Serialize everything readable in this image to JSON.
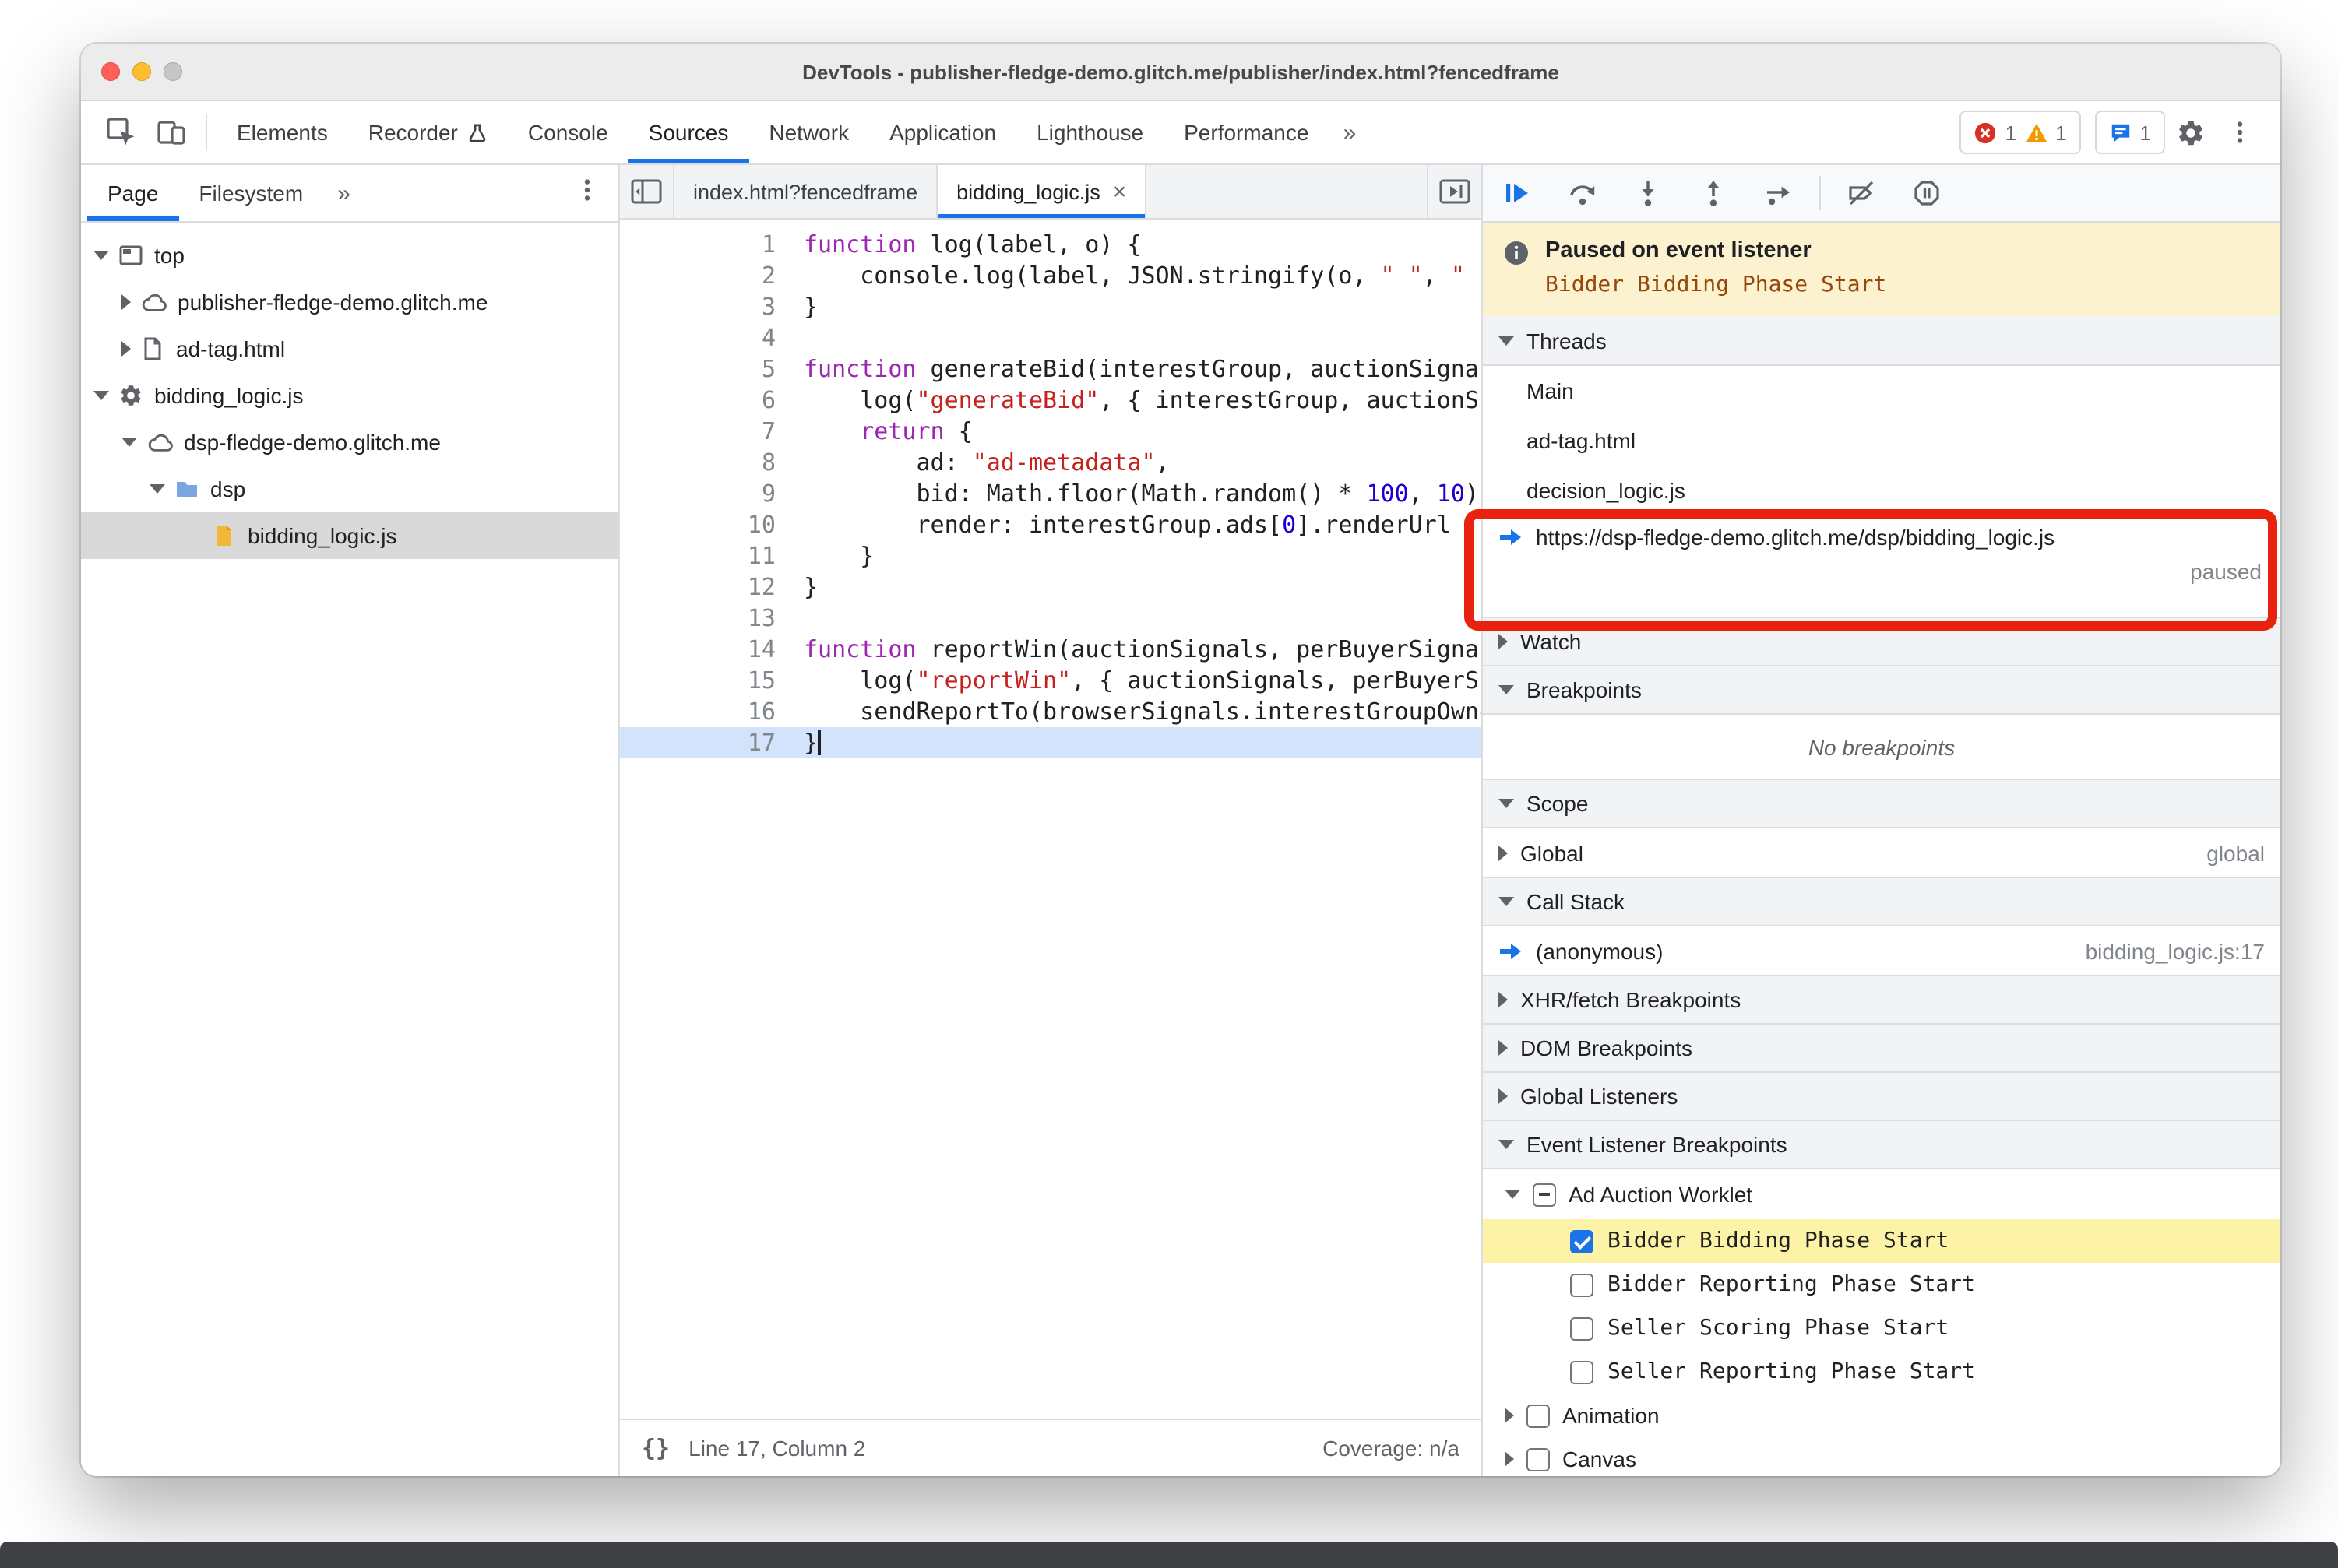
{
  "window": {
    "title": "DevTools - publisher-fledge-demo.glitch.me/publisher/index.html?fencedframe"
  },
  "toolbar": {
    "tabs": [
      "Elements",
      "Recorder",
      "Console",
      "Sources",
      "Network",
      "Application",
      "Lighthouse",
      "Performance"
    ],
    "selected_tab": "Sources",
    "overflow": "»",
    "error_count": "1",
    "warning_count": "1",
    "issues_count": "1"
  },
  "sidebar": {
    "tabs": [
      "Page",
      "Filesystem"
    ],
    "selected_tab": "Page",
    "overflow": "»",
    "tree": [
      {
        "label": "top"
      },
      {
        "label": "publisher-fledge-demo.glitch.me"
      },
      {
        "label": "ad-tag.html"
      },
      {
        "label": "bidding_logic.js"
      },
      {
        "label": "dsp-fledge-demo.glitch.me"
      },
      {
        "label": "dsp"
      },
      {
        "label": "bidding_logic.js"
      }
    ]
  },
  "editor": {
    "tabs": [
      {
        "label": "index.html?fencedframe"
      },
      {
        "label": "bidding_logic.js",
        "close": "×"
      }
    ],
    "active_tab": "bidding_logic.js",
    "paused_line": 17,
    "lines": [
      [
        {
          "t": "k",
          "v": "function"
        },
        {
          "t": "d",
          "v": " log(label, o) {"
        }
      ],
      [
        {
          "t": "d",
          "v": "    console.log(label, JSON.stringify(o, "
        },
        {
          "t": "s",
          "v": "\" \""
        },
        {
          "t": "d",
          "v": ", "
        },
        {
          "t": "s",
          "v": "\" \""
        },
        {
          "t": "d",
          "v": "));"
        }
      ],
      [
        {
          "t": "d",
          "v": "}"
        }
      ],
      [],
      [
        {
          "t": "k",
          "v": "function"
        },
        {
          "t": "d",
          "v": " generateBid(interestGroup, auctionSignals, perBuyerSignals) {"
        }
      ],
      [
        {
          "t": "d",
          "v": "    log("
        },
        {
          "t": "s",
          "v": "\"generateBid\""
        },
        {
          "t": "d",
          "v": ", { interestGroup, auctionSignals, perBuyerSignals });"
        }
      ],
      [
        {
          "t": "d",
          "v": "    "
        },
        {
          "t": "k",
          "v": "return"
        },
        {
          "t": "d",
          "v": " {"
        }
      ],
      [
        {
          "t": "d",
          "v": "        ad: "
        },
        {
          "t": "s",
          "v": "\"ad-metadata\""
        },
        {
          "t": "d",
          "v": ","
        }
      ],
      [
        {
          "t": "d",
          "v": "        bid: Math.floor(Math.random() * "
        },
        {
          "t": "n",
          "v": "100"
        },
        {
          "t": "d",
          "v": ", "
        },
        {
          "t": "n",
          "v": "10"
        },
        {
          "t": "d",
          "v": "),"
        }
      ],
      [
        {
          "t": "d",
          "v": "        render: interestGroup.ads["
        },
        {
          "t": "n",
          "v": "0"
        },
        {
          "t": "d",
          "v": "].renderUrl"
        }
      ],
      [
        {
          "t": "d",
          "v": "    }"
        }
      ],
      [
        {
          "t": "d",
          "v": "}"
        }
      ],
      [],
      [
        {
          "t": "k",
          "v": "function"
        },
        {
          "t": "d",
          "v": " reportWin(auctionSignals, perBuyerSignals, sellerSignals) {"
        }
      ],
      [
        {
          "t": "d",
          "v": "    log("
        },
        {
          "t": "s",
          "v": "\"reportWin\""
        },
        {
          "t": "d",
          "v": ", { auctionSignals, perBuyerSignals, sellerSignals });"
        }
      ],
      [
        {
          "t": "d",
          "v": "    sendReportTo(browserSignals.interestGroupOwner);"
        }
      ],
      [
        {
          "t": "d",
          "v": "}"
        }
      ]
    ],
    "status": {
      "pretty_print": "{}",
      "line_col": "Line 17, Column 2",
      "coverage": "Coverage: n/a"
    }
  },
  "debugger": {
    "paused_banner": {
      "title": "Paused on event listener",
      "event": "Bidder Bidding Phase Start"
    },
    "threads": {
      "title": "Threads",
      "items": [
        "Main",
        "ad-tag.html",
        "decision_logic.js"
      ],
      "active": {
        "url": "https://dsp-fledge-demo.glitch.me/dsp/bidding_logic.js",
        "state": "paused"
      }
    },
    "watch": {
      "title": "Watch"
    },
    "breakpoints": {
      "title": "Breakpoints",
      "empty_message": "No breakpoints"
    },
    "scope": {
      "title": "Scope",
      "rows": [
        {
          "name": "Global",
          "value": "global"
        }
      ]
    },
    "call_stack": {
      "title": "Call Stack",
      "frames": [
        {
          "name": "(anonymous)",
          "location": "bidding_logic.js:17"
        }
      ]
    },
    "xhr_breakpoints": {
      "title": "XHR/fetch Breakpoints"
    },
    "dom_breakpoints": {
      "title": "DOM Breakpoints"
    },
    "global_listeners": {
      "title": "Global Listeners"
    },
    "event_listener_breakpoints": {
      "title": "Event Listener Breakpoints",
      "categories": [
        {
          "label": "Ad Auction Worklet",
          "state": "indeterminate",
          "expanded": true,
          "items": [
            {
              "label": "Bidder Bidding Phase Start",
              "checked": true,
              "highlighted": true
            },
            {
              "label": "Bidder Reporting Phase Start",
              "checked": false
            },
            {
              "label": "Seller Scoring Phase Start",
              "checked": false
            },
            {
              "label": "Seller Reporting Phase Start",
              "checked": false
            }
          ]
        },
        {
          "label": "Animation",
          "state": "unchecked",
          "expanded": false
        },
        {
          "label": "Canvas",
          "state": "unchecked",
          "expanded": false
        }
      ]
    }
  },
  "icons": {
    "inspect": "cursor-in-box",
    "device_toolbar": "phone-tablet",
    "experiment": "flask",
    "error": "red-circle-x",
    "warning": "yellow-triangle-exclaim",
    "issues": "blue-speech-bubble",
    "settings": "gear",
    "menu": "kebab-dots",
    "resume": "blue-bar-play",
    "step_over": "arc-arrow-over-dot",
    "step_into": "arrow-down-to-dot",
    "step_out": "arrow-up-from-dot",
    "step": "arrow-right-over-dot",
    "deactivate_breakpoints": "slashed-breakpoint-tag",
    "pause_on_exceptions": "pause-in-octagon",
    "info": "circle-i",
    "execution_position": "blue-right-arrow",
    "pretty_print": "curly-braces"
  },
  "colors": {
    "accent": "#1a73e8",
    "error-red": "#d93025",
    "warning-yellow": "#f29900",
    "annotation-red": "#e8220f",
    "banner-bg": "#fdf2d0",
    "banner-event": "#96480b",
    "paused-line-bg": "#d3e3fc",
    "elb-highlight": "#fdf3a6",
    "selection-gray": "#d9d9d9"
  }
}
